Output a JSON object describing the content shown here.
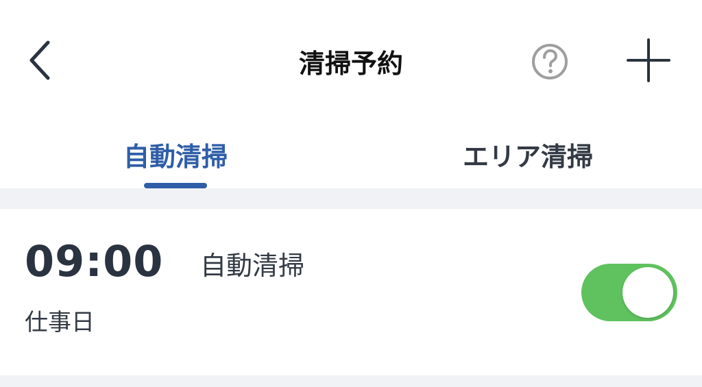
{
  "header": {
    "title": "清掃予約",
    "back_icon": "chevron-left-icon",
    "help_icon": "question-circle-icon",
    "add_icon": "plus-icon"
  },
  "tabs": [
    {
      "label": "自動清掃",
      "active": true
    },
    {
      "label": "エリア清掃",
      "active": false
    }
  ],
  "schedules": [
    {
      "time": "09:00",
      "mode": "自動清掃",
      "days": "仕事日",
      "enabled": true
    }
  ],
  "colors": {
    "accent": "#2f5ea8",
    "toggle_on": "#5fc25f",
    "background": "#f0f2f5"
  }
}
